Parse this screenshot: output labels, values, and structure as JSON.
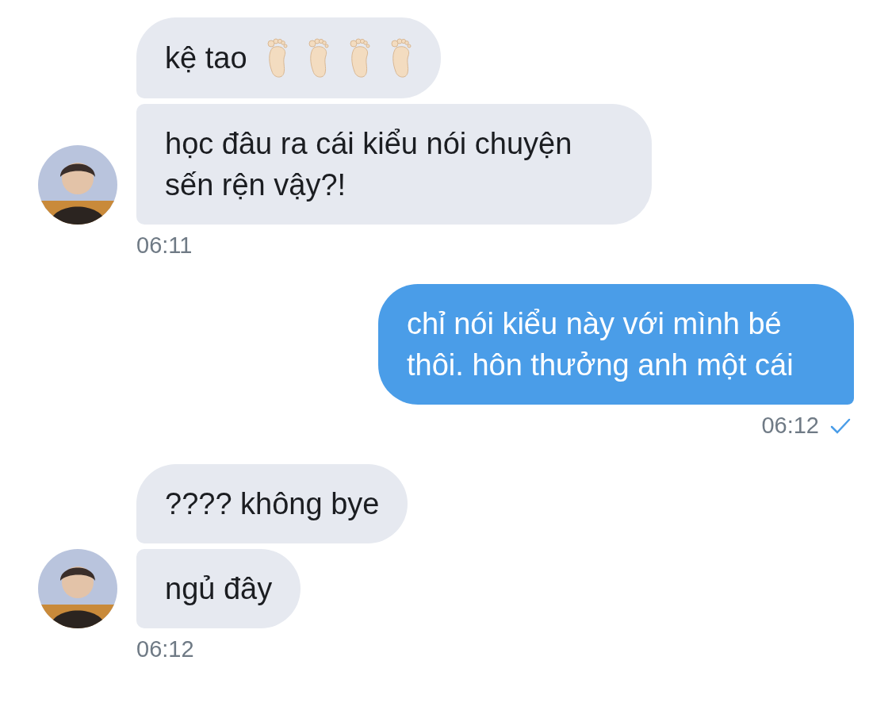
{
  "groups": [
    {
      "kind": "incoming",
      "time": "06:11",
      "read": false,
      "messages": [
        {
          "parts": [
            {
              "kind": "text",
              "text": "kệ tao"
            },
            {
              "kind": "foot"
            },
            {
              "kind": "foot"
            },
            {
              "kind": "foot"
            },
            {
              "kind": "foot"
            }
          ]
        },
        {
          "parts": [
            {
              "kind": "text",
              "text": "học đâu ra cái kiểu nói chuyện sến rện vậy?!"
            }
          ]
        }
      ]
    },
    {
      "kind": "outgoing",
      "time": "06:12",
      "read": true,
      "messages": [
        {
          "parts": [
            {
              "kind": "text",
              "text": "chỉ nói kiểu này với mình bé thôi. hôn thưởng anh một cái"
            }
          ]
        }
      ]
    },
    {
      "kind": "incoming",
      "time": "06:12",
      "read": false,
      "messages": [
        {
          "parts": [
            {
              "kind": "text",
              "text": "???? không bye"
            }
          ]
        },
        {
          "parts": [
            {
              "kind": "text",
              "text": "ngủ đây"
            }
          ]
        }
      ]
    }
  ]
}
